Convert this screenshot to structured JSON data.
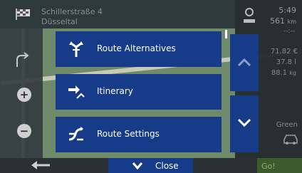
{
  "header": {
    "address_line1": "Schillerstraße 4",
    "address_line2": "Düsseltal"
  },
  "info": {
    "time": "5:49",
    "distance": "561",
    "distance_unit": "km",
    "dashes": "--:--",
    "cost": "71.82 €",
    "fuel": "37.8 l",
    "weight": "88.1",
    "weight_unit": "kg",
    "eco_label": "Green"
  },
  "menu": {
    "items": [
      {
        "label": "Route Alternatives",
        "icon": "route-alternatives-icon"
      },
      {
        "label": "Itinerary",
        "icon": "itinerary-icon"
      },
      {
        "label": "Route Settings",
        "icon": "route-settings-icon"
      }
    ]
  },
  "bottom": {
    "close_label": "Close",
    "go_label": "Go!"
  },
  "colors": {
    "menu_blue": "#163b89",
    "panel_dark": "#2b3134",
    "go_green": "#3c5a2c"
  }
}
